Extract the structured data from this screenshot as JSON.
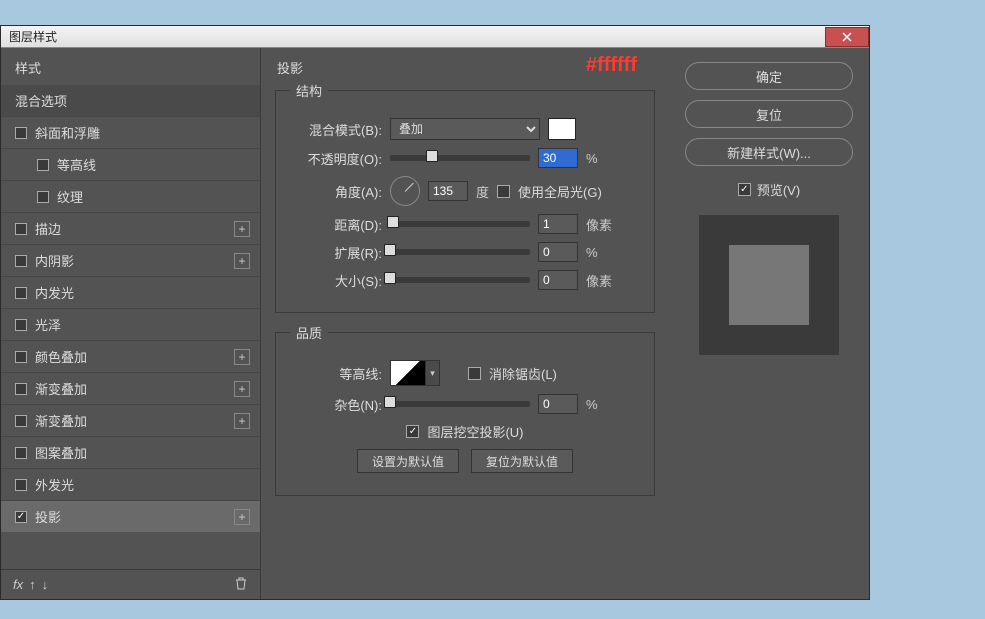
{
  "window": {
    "title": "图层样式"
  },
  "annotation": "#ffffff",
  "sidebar": {
    "header": "样式",
    "subheader": "混合选项",
    "items": [
      {
        "label": "斜面和浮雕",
        "checked": false,
        "plus": false,
        "indent": false
      },
      {
        "label": "等高线",
        "checked": false,
        "plus": false,
        "indent": true
      },
      {
        "label": "纹理",
        "checked": false,
        "plus": false,
        "indent": true
      },
      {
        "label": "描边",
        "checked": false,
        "plus": true,
        "indent": false
      },
      {
        "label": "内阴影",
        "checked": false,
        "plus": true,
        "indent": false
      },
      {
        "label": "内发光",
        "checked": false,
        "plus": false,
        "indent": false
      },
      {
        "label": "光泽",
        "checked": false,
        "plus": false,
        "indent": false
      },
      {
        "label": "颜色叠加",
        "checked": false,
        "plus": true,
        "indent": false
      },
      {
        "label": "渐变叠加",
        "checked": false,
        "plus": true,
        "indent": false
      },
      {
        "label": "渐变叠加",
        "checked": false,
        "plus": true,
        "indent": false
      },
      {
        "label": "图案叠加",
        "checked": false,
        "plus": false,
        "indent": false
      },
      {
        "label": "外发光",
        "checked": false,
        "plus": false,
        "indent": false
      },
      {
        "label": "投影",
        "checked": true,
        "plus": true,
        "indent": false,
        "selected": true
      }
    ],
    "footer_fx": "fx"
  },
  "panel": {
    "title": "投影",
    "structure": {
      "legend": "结构",
      "blend_label": "混合模式(B):",
      "blend_value": "叠加",
      "color": "#ffffff",
      "opacity_label": "不透明度(O):",
      "opacity_value": "30",
      "opacity_unit": "%",
      "angle_label": "角度(A):",
      "angle_value": "135",
      "angle_unit": "度",
      "global_light_label": "使用全局光(G)",
      "global_light_checked": false,
      "distance_label": "距离(D):",
      "distance_value": "1",
      "distance_unit": "像素",
      "spread_label": "扩展(R):",
      "spread_value": "0",
      "spread_unit": "%",
      "size_label": "大小(S):",
      "size_value": "0",
      "size_unit": "像素"
    },
    "quality": {
      "legend": "品质",
      "contour_label": "等高线:",
      "antialias_label": "消除锯齿(L)",
      "antialias_checked": false,
      "noise_label": "杂色(N):",
      "noise_value": "0",
      "noise_unit": "%",
      "knockout_label": "图层挖空投影(U)",
      "knockout_checked": true,
      "set_default": "设置为默认值",
      "reset_default": "复位为默认值"
    }
  },
  "right": {
    "ok": "确定",
    "cancel": "复位",
    "new_style": "新建样式(W)...",
    "preview_label": "预览(V)",
    "preview_checked": true
  }
}
